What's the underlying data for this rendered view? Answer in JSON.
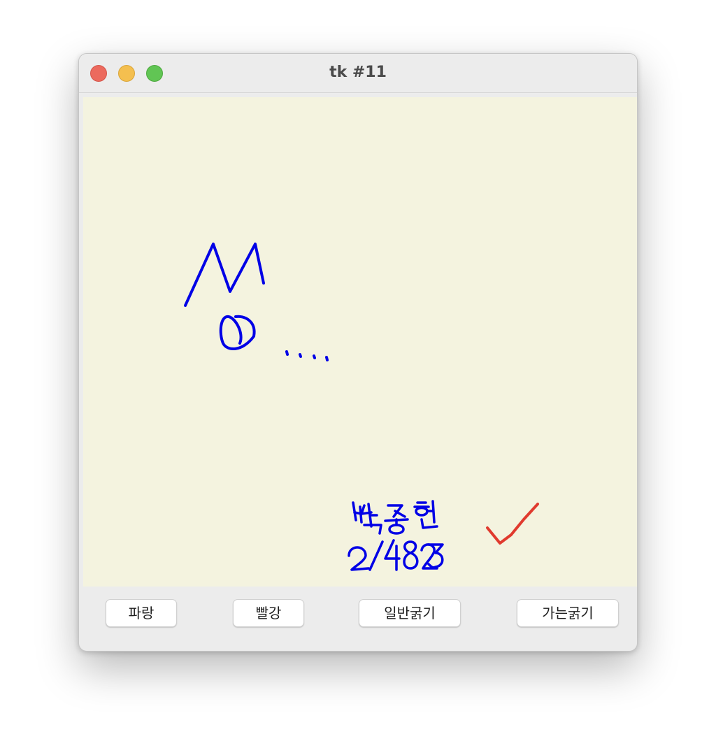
{
  "window": {
    "title": "tk #11"
  },
  "canvas": {
    "background_color": "#f4f3df",
    "drawings": [
      {
        "description_id": "letter-M",
        "color": "#0000e6"
      },
      {
        "description_id": "letter-O",
        "color": "#0000e6"
      },
      {
        "description_id": "dots",
        "color": "#0000e6"
      },
      {
        "description_id": "name-text",
        "color": "#0000e6"
      },
      {
        "description_id": "id-number-text",
        "color": "#0000e6"
      },
      {
        "description_id": "checkmark",
        "color": "#e03a2e"
      }
    ],
    "handwritten_name": "박종현",
    "handwritten_number": "2/4823"
  },
  "buttons": {
    "blue_label": "파랑",
    "red_label": "빨강",
    "normal_thickness_label": "일반굵기",
    "thin_thickness_label": "가는굵기"
  },
  "colors": {
    "pen_blue": "#0000e6",
    "pen_red": "#e03a2e",
    "close": "#ec6a5e",
    "minimize": "#f4bf4f",
    "maximize": "#61c554"
  }
}
